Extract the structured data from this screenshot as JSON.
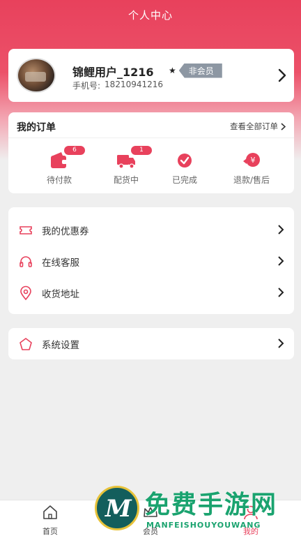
{
  "header": {
    "title": "个人中心"
  },
  "profile": {
    "username": "锦鲤用户_1216",
    "phone_label": "手机号:",
    "phone": "18210941216",
    "member_star": "★",
    "member_status": "非会员"
  },
  "orders": {
    "title": "我的订单",
    "view_all": "查看全部订单",
    "items": [
      {
        "label": "待付款",
        "badge": "6",
        "icon": "wallet-icon"
      },
      {
        "label": "配货中",
        "badge": "1",
        "icon": "truck-icon"
      },
      {
        "label": "已完成",
        "badge": "",
        "icon": "check-circle-icon"
      },
      {
        "label": "退款/售后",
        "badge": "",
        "icon": "refund-icon"
      }
    ]
  },
  "menu": {
    "items": [
      {
        "label": "我的优惠券",
        "icon": "coupon-icon"
      },
      {
        "label": "在线客服",
        "icon": "headset-icon"
      },
      {
        "label": "收货地址",
        "icon": "location-pin-icon"
      }
    ],
    "settings": {
      "label": "系统设置",
      "icon": "pentagon-icon"
    }
  },
  "tabbar": {
    "tabs": [
      {
        "label": "首页",
        "icon": "home-icon"
      },
      {
        "label": "会员",
        "icon": "crown-icon"
      },
      {
        "label": "我的",
        "icon": "user-icon",
        "active": true
      }
    ]
  },
  "watermark": {
    "title": "免费手游网",
    "subtitle": "MANFEISHOUYOUWANG"
  },
  "colors": {
    "accent": "#e8415c",
    "badge_gray": "#8d97a3",
    "watermark_green": "#1aa36f"
  }
}
